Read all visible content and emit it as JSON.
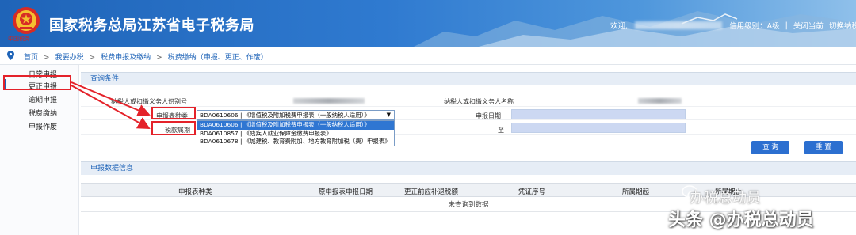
{
  "header": {
    "emblem_caption": "中国税务",
    "site_title": "国家税务总局江苏省电子税务局",
    "welcome": "欢迎,",
    "credit_level": "信用级别：A级",
    "close_page": "关闭当前",
    "switch_taxpayer": "切换纳税人",
    "sep": "|"
  },
  "breadcrumb": {
    "items": [
      "首页",
      "我要办税",
      "税费申报及缴纳",
      "税费缴纳（申报、更正、作废）"
    ],
    "separator": ">"
  },
  "sidebar": {
    "items": [
      {
        "label": "日常申报"
      },
      {
        "label": "更正申报"
      },
      {
        "label": "逾期申报"
      },
      {
        "label": "税费缴纳"
      },
      {
        "label": "申报作废"
      }
    ]
  },
  "query": {
    "title": "查询条件",
    "taxpayer_id_label": "纳税人或扣缴义务人识别号",
    "taxpayer_name_label": "纳税人或扣缴义务人名称",
    "form_type_label": "申报表种类",
    "tax_period_label": "税款属期",
    "declare_date_label": "申报日期",
    "to_label": "至",
    "selected_form": "BDA0610606 | 《增值税及附加税费申报表（一般纳税人适用）》",
    "dropdown_arrow": "▼",
    "options": [
      "BDA0610606 | 《增值税及附加税费申报表（一般纳税人适用）》",
      "BDA0610857 | 《残疾人就业保障金缴费申报表》",
      "BDA0610678 | 《城建税、教育费附加、地方教育附加税（费）申报表》"
    ],
    "query_button": "查 询",
    "reset_button": "重 置"
  },
  "results": {
    "title": "申报数据信息",
    "columns": [
      "申报表种类",
      "原申报表申报日期",
      "更正前应补退税额",
      "凭证序号",
      "所属期起",
      "所属期止"
    ],
    "empty_text": "未查询到数据"
  },
  "watermark": {
    "line1": "办税总动员",
    "line2": "头条 @办税总动员"
  },
  "colors": {
    "brand_blue": "#1f64b8",
    "selected_option": "#2f76d2",
    "annotation_red": "#e4222a",
    "date_field_fill": "#ccd8f2"
  }
}
